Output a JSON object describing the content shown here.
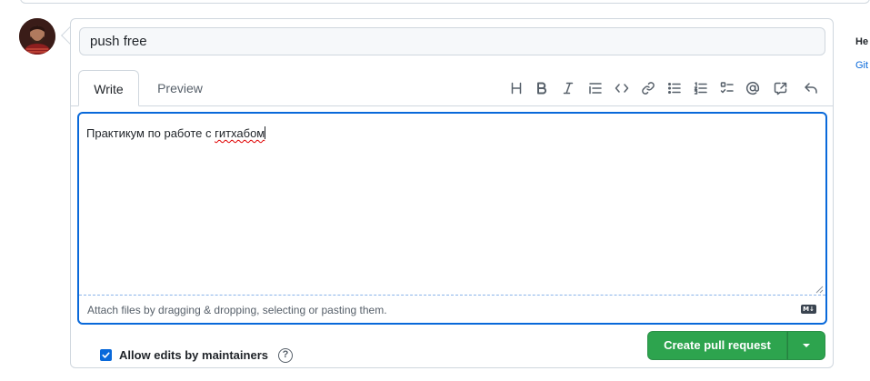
{
  "pr_form": {
    "title_value": "push free",
    "tabs": [
      {
        "label": "Write",
        "active": true
      },
      {
        "label": "Preview",
        "active": false
      }
    ],
    "toolbar_icons": [
      "heading-icon",
      "bold-icon",
      "italic-icon",
      "quote-icon",
      "code-icon",
      "link-icon",
      "unordered-list-icon",
      "ordered-list-icon",
      "task-list-icon",
      "mention-icon",
      "reference-icon",
      "reply-icon"
    ],
    "body_text_plain": "Практикум по работе с ",
    "body_text_misspelled": "гитхабом",
    "attach_hint": "Attach files by dragging & dropping, selecting or pasting them.",
    "markdown_badge": "M↓"
  },
  "maintainers": {
    "label": "Allow edits by maintainers",
    "checked": true,
    "help_glyph": "?"
  },
  "actions": {
    "create_label": "Create pull request"
  },
  "sidebar": {
    "heading": "He",
    "link": "Git"
  },
  "colors": {
    "accent": "#0969da",
    "primary_button": "#2da44e",
    "border": "#d0d7de",
    "muted_text": "#57606a"
  }
}
